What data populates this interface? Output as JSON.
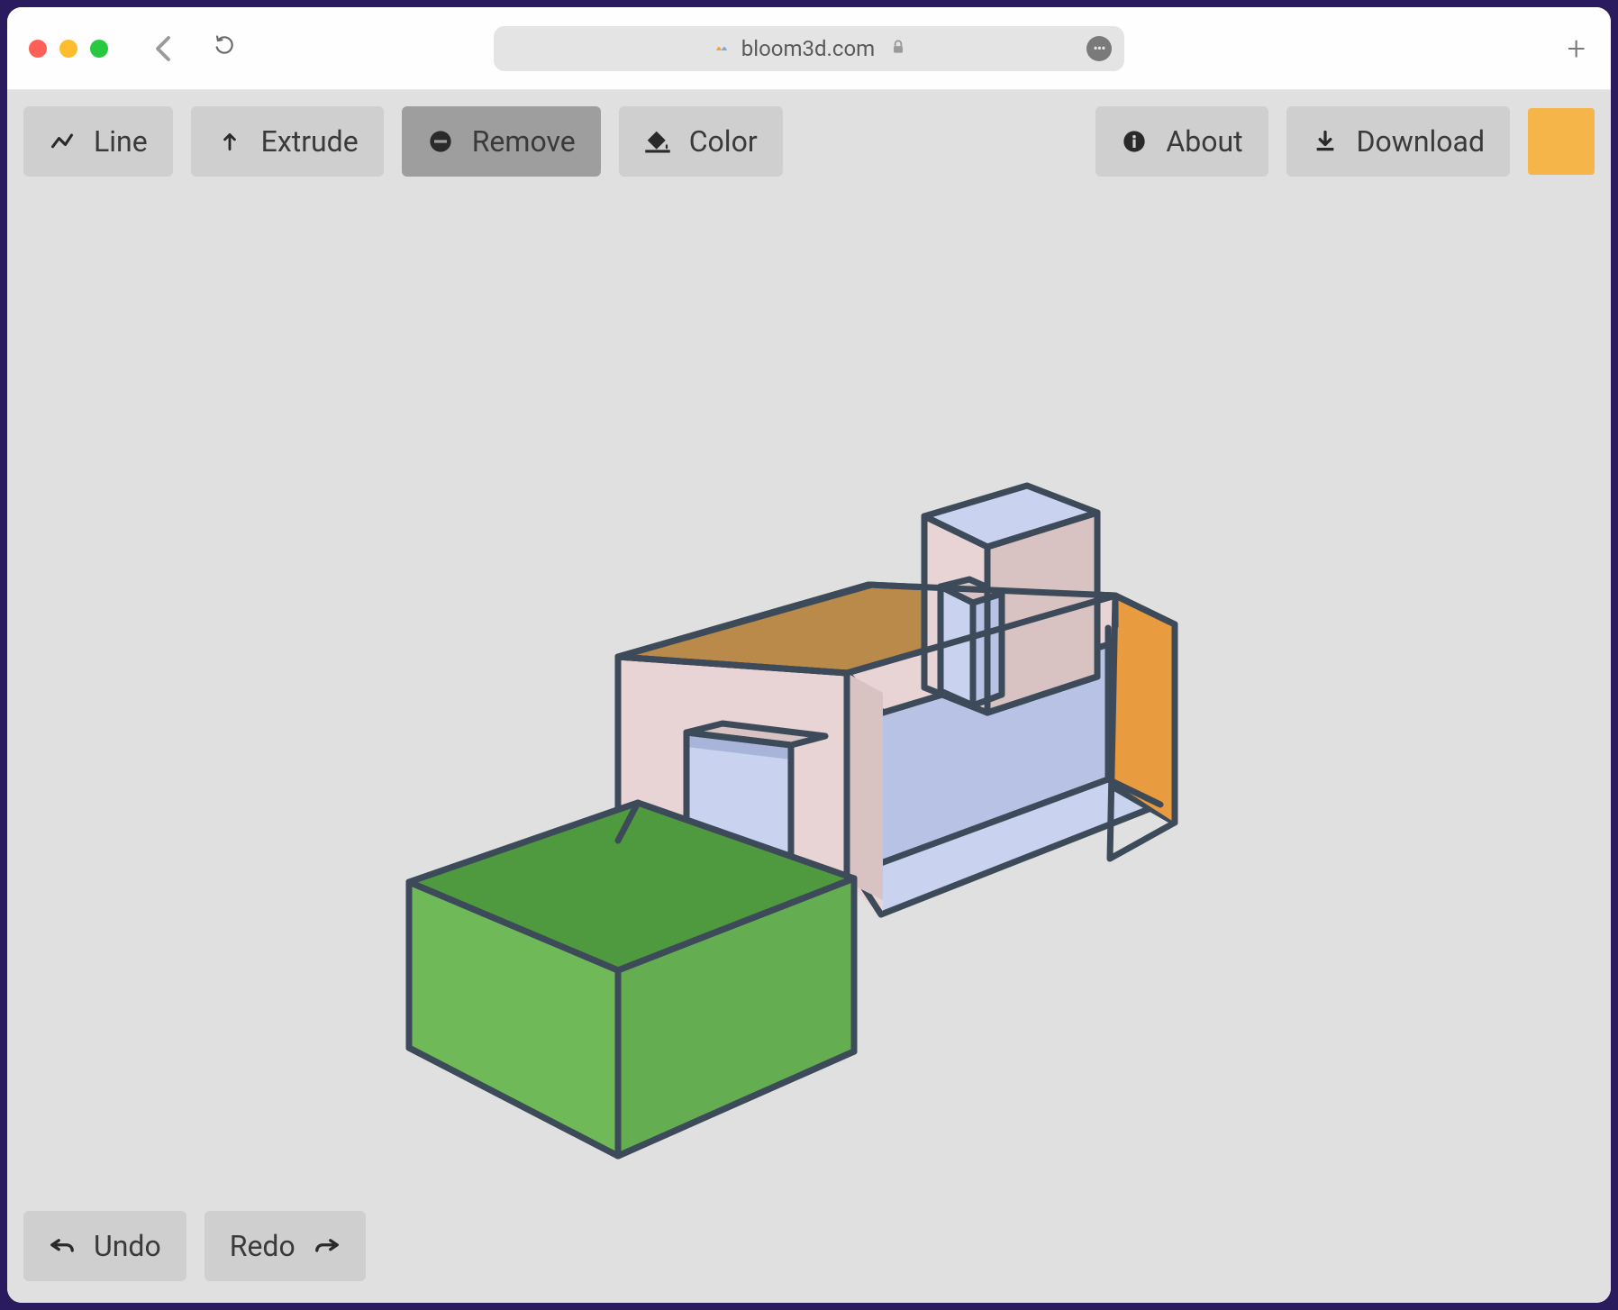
{
  "browser": {
    "url": "bloom3d.com"
  },
  "toolbar": {
    "line_label": "Line",
    "extrude_label": "Extrude",
    "remove_label": "Remove",
    "color_label": "Color",
    "about_label": "About",
    "download_label": "Download",
    "active_tool": "remove",
    "swatch_color": "#f5b548"
  },
  "bottombar": {
    "undo_label": "Undo",
    "redo_label": "Redo"
  },
  "scene": {
    "stroke": "#3d4a5a",
    "colors": {
      "green_top": "#4f9a3f",
      "green_front": "#6fb959",
      "pink": "#e8d4d4",
      "pink_shade": "#d9c2c2",
      "brown_top": "#b98a4a",
      "orange_side": "#e89b3f",
      "blue_floor": "#c9d2ee",
      "blue_wall": "#b8c2e4",
      "blue_shade": "#a8b4da"
    }
  }
}
